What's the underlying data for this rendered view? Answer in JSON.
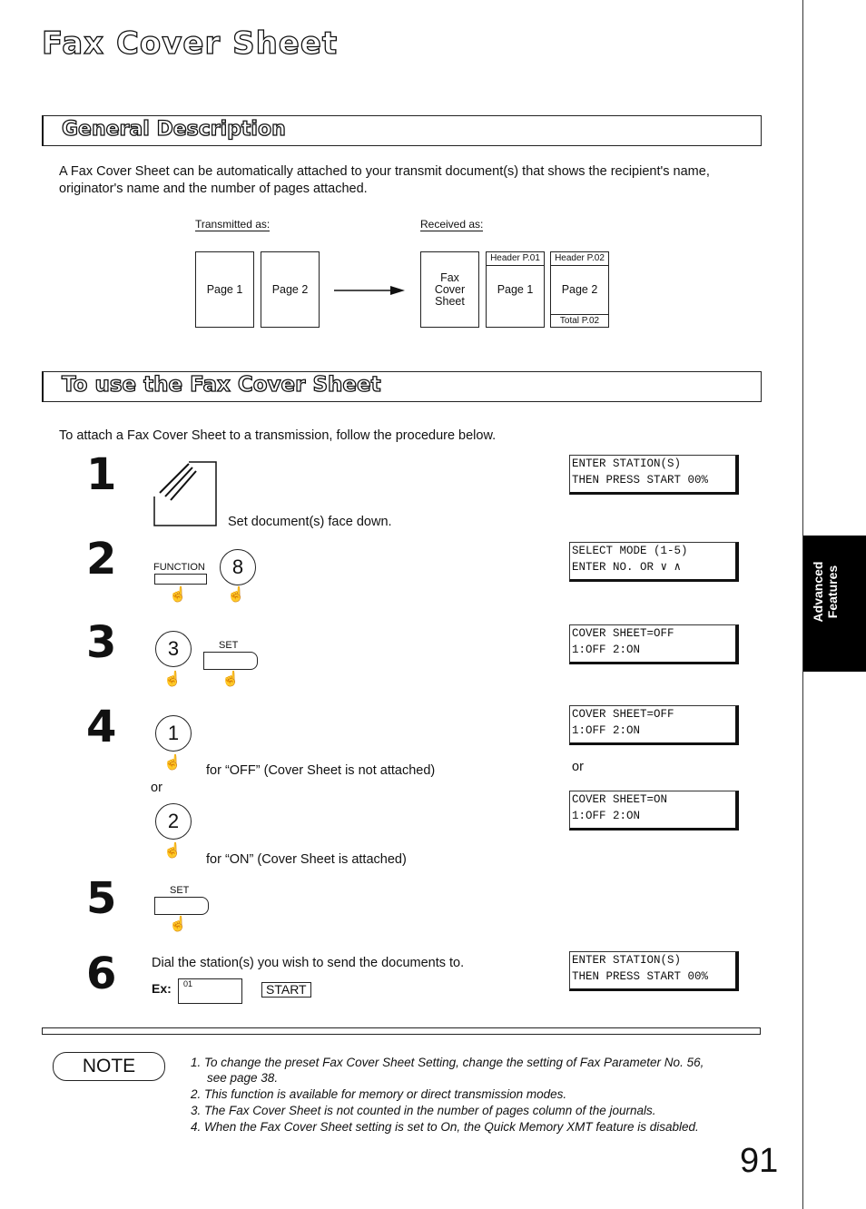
{
  "title": "Fax Cover Sheet",
  "sections": {
    "general": "General Description",
    "use": "To use the Fax Cover Sheet"
  },
  "description": "A Fax Cover Sheet can be automatically attached to your transmit document(s) that shows the recipient's name, originator's name and the number of pages attached.",
  "diagram": {
    "transmitted_label": "Transmitted as:",
    "received_label": "Received as:",
    "tx_pages": [
      "Page 1",
      "Page 2"
    ],
    "cover": "Fax Cover Sheet",
    "rx_pages": [
      "Page 1",
      "Page 2"
    ],
    "headers": [
      "Header P.01",
      "Header P.02"
    ],
    "total": "Total P.02"
  },
  "intro": "To attach a Fax Cover Sheet to a transmission, follow the procedure below.",
  "steps": {
    "s1": {
      "num": "1",
      "text": "Set document(s) face down.",
      "lcd": [
        "ENTER STATION(S)",
        "THEN PRESS START 00%"
      ]
    },
    "s2": {
      "num": "2",
      "key": "FUNCTION",
      "digit": "8",
      "lcd": [
        "SELECT MODE    (1-5)",
        "ENTER NO.  OR ∨ ∧"
      ]
    },
    "s3": {
      "num": "3",
      "digit": "3",
      "key": "SET",
      "lcd": [
        "COVER SHEET=OFF",
        "1:OFF 2:ON"
      ]
    },
    "s4": {
      "num": "4",
      "digit1": "1",
      "text1": "for “OFF” (Cover Sheet is not attached)",
      "or": "or",
      "digit2": "2",
      "text2": "for “ON” (Cover Sheet is attached)",
      "lcd1": [
        "COVER SHEET=OFF",
        "1:OFF 2:ON"
      ],
      "lcd2": [
        "COVER SHEET=ON",
        "1:OFF 2:ON"
      ]
    },
    "s5": {
      "num": "5",
      "key": "SET"
    },
    "s6": {
      "num": "6",
      "text": "Dial the station(s) you wish to send the documents to.",
      "ex": "Ex:",
      "ex_value": "01",
      "start": "START",
      "lcd": [
        "ENTER STATION(S)",
        "THEN PRESS START 00%"
      ]
    }
  },
  "note_label": "NOTE",
  "notes": [
    "1.  To change the preset Fax Cover Sheet Setting, change the setting of Fax Parameter No. 56,",
    "see page 38.",
    "2.  This function is available for memory or direct transmission modes.",
    "3.  The Fax Cover Sheet is not counted in the number of pages column of the journals.",
    "4.   When the Fax Cover Sheet setting is set to On, the Quick Memory XMT feature is disabled."
  ],
  "side_tab": [
    "Advanced",
    "Features"
  ],
  "page_number": "91"
}
